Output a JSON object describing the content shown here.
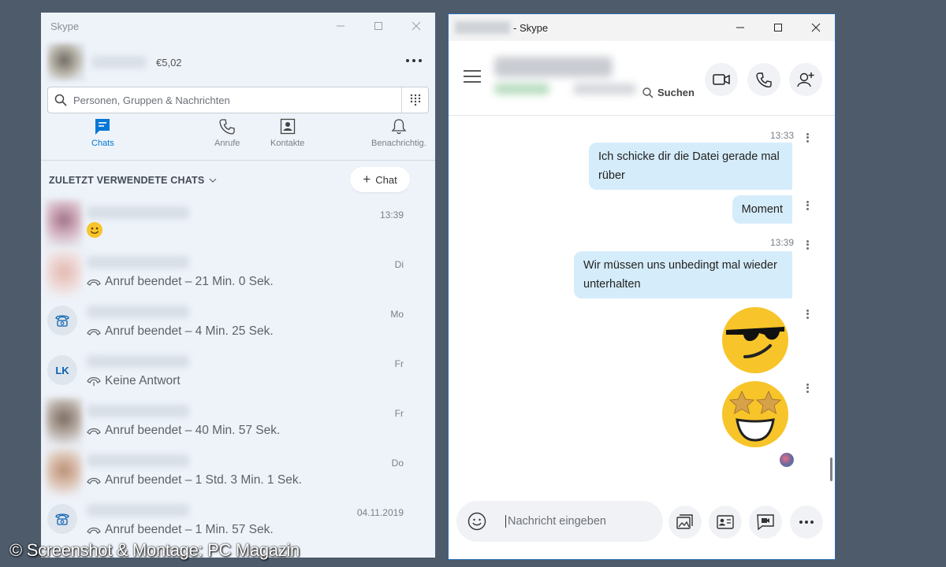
{
  "left_window": {
    "title": "Skype",
    "profile": {
      "credit": "€5,02"
    },
    "search": {
      "placeholder": "Personen, Gruppen & Nachrichten"
    },
    "nav": [
      {
        "label": "Chats",
        "icon": "chat-icon",
        "active": true
      },
      {
        "label": "Anrufe",
        "icon": "phone-icon"
      },
      {
        "label": "Kontakte",
        "icon": "contacts-icon"
      },
      {
        "label": "Benachrichtig.",
        "icon": "bell-icon"
      }
    ],
    "section_title": "ZULETZT VERWENDETE CHATS",
    "new_chat_label": "Chat",
    "chats": [
      {
        "time": "13:39",
        "message": "",
        "emoji": "smiley-icon"
      },
      {
        "time": "Di",
        "message": "Anruf beendet – 21 Min. 0 Sek."
      },
      {
        "time": "Mo",
        "message": "Anruf beendet – 4 Min. 25 Sek."
      },
      {
        "time": "Fr",
        "message": "Keine Antwort",
        "initials": "LK"
      },
      {
        "time": "Fr",
        "message": "Anruf beendet – 40 Min. 57 Sek."
      },
      {
        "time": "Do",
        "message": "Anruf beendet – 1 Std. 3 Min. 1 Sek."
      },
      {
        "time": "04.11.2019",
        "message": "Anruf beendet – 1 Min. 57 Sek."
      }
    ]
  },
  "right_window": {
    "title": "- Skype",
    "search_label": "Suchen",
    "messages": [
      {
        "time": "13:33",
        "text": "Ich schicke dir die Datei gerade mal rüber"
      },
      {
        "text": "Moment"
      },
      {
        "time": "13:39",
        "text": "Wir müssen uns unbedingt mal wieder unterhalten"
      }
    ],
    "emojis": [
      "sunglasses-emoji",
      "star-struck-emoji"
    ],
    "composer": {
      "placeholder": "Nachricht eingeben"
    }
  },
  "watermark": "© Screenshot & Montage: PC Magazin",
  "colors": {
    "accent": "#0078d4",
    "bubble": "#d5ecfa",
    "sidebar_bg": "#eef3fa",
    "emoji_yellow": "#f7c42a"
  }
}
